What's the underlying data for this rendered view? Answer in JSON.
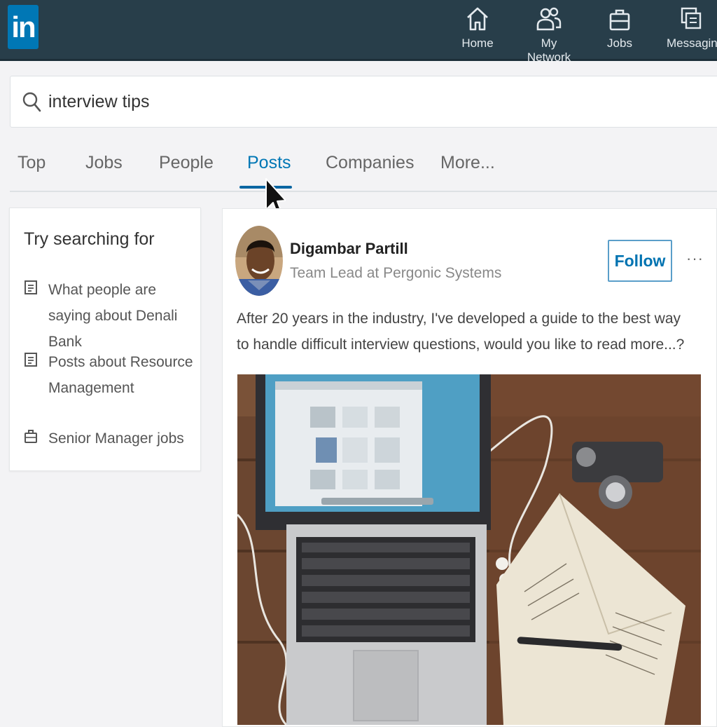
{
  "app": {
    "logo_text": "in",
    "brand_color": "#0077b5",
    "topbar_color": "#283e4a"
  },
  "nav": {
    "items": [
      {
        "label": "Home",
        "icon": "home-icon"
      },
      {
        "label": "My Network",
        "icon": "network-icon"
      },
      {
        "label": "Jobs",
        "icon": "briefcase-icon"
      },
      {
        "label": "Messaging",
        "icon": "messaging-icon"
      }
    ]
  },
  "search": {
    "value": "interview tips",
    "icon": "search-icon"
  },
  "tabs": {
    "items": [
      {
        "label": "Top"
      },
      {
        "label": "Jobs"
      },
      {
        "label": "People"
      },
      {
        "label": "Posts"
      },
      {
        "label": "Companies"
      },
      {
        "label": "More..."
      }
    ],
    "active": "Posts"
  },
  "sidebar": {
    "title": "Try searching for",
    "suggestions": [
      {
        "label": "What people are saying about Denali Bank",
        "icon": "document-icon"
      },
      {
        "label": "Posts about Resource Management",
        "icon": "document-icon"
      },
      {
        "label": "Senior Manager jobs",
        "icon": "briefcase-icon"
      }
    ]
  },
  "post": {
    "author_name": "Digambar Partill",
    "author_title": "Team Lead at Pergonic Systems",
    "follow_label": "Follow",
    "more_label": "···",
    "text": "After 20 years in the industry, I've developed a guide to the best way to handle difficult interview questions, would you like to read more...?",
    "image_subject": "laptop-notebook-camera-desk-photo"
  }
}
